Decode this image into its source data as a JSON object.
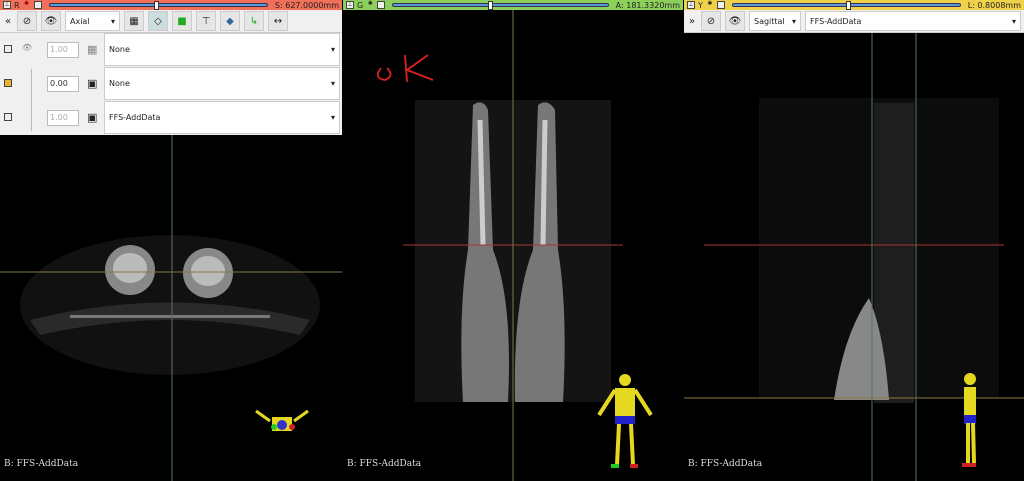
{
  "red": {
    "letter": "R",
    "offset": "S: 627.0000mm",
    "orientation": "Axial",
    "slider_pos": 0.48,
    "layers": [
      {
        "opacity": "1.00",
        "volume": "None"
      },
      {
        "opacity": "0.00",
        "volume": "None"
      },
      {
        "opacity": "1.00",
        "volume": "FFS-AddData"
      }
    ],
    "label": "B: FFS-AddData",
    "color": "#f0705a"
  },
  "green": {
    "letter": "G",
    "offset": "A: 181.3320mm",
    "slider_pos": 0.44,
    "label": "B: FFS-AddData",
    "color": "#8ccf5a"
  },
  "yellow": {
    "letter": "Y",
    "offset": "L: 0.8008mm",
    "orientation": "Sagittal",
    "volume": "FFS-AddData",
    "slider_pos": 0.5,
    "label": "B: FFS-AddData",
    "color": "#f0d24a"
  },
  "annotation": {
    "text": "OK"
  }
}
